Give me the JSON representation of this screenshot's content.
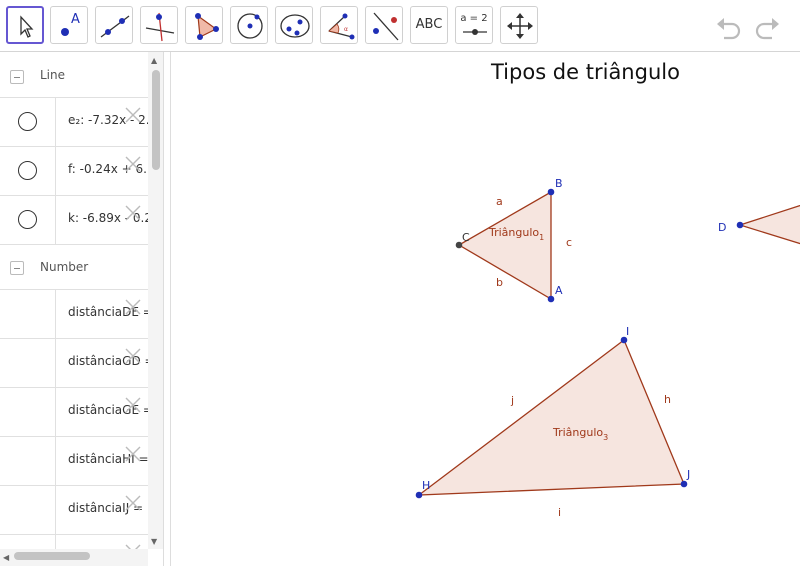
{
  "toolbar": {
    "tools": [
      {
        "name": "move-tool",
        "icon": "cursor-arrow-icon",
        "active": true
      },
      {
        "name": "point-tool",
        "icon": "point-icon",
        "label": "A"
      },
      {
        "name": "line-tool",
        "icon": "line-through-points-icon"
      },
      {
        "name": "perpendicular-line-tool",
        "icon": "perpendicular-line-icon"
      },
      {
        "name": "polygon-tool",
        "icon": "polygon-icon"
      },
      {
        "name": "circle-tool",
        "icon": "circle-center-point-icon"
      },
      {
        "name": "ellipse-tool",
        "icon": "ellipse-icon"
      },
      {
        "name": "angle-tool",
        "icon": "angle-icon"
      },
      {
        "name": "reflect-tool",
        "icon": "reflect-line-icon"
      },
      {
        "name": "text-tool",
        "icon": "text-icon",
        "label": "ABC"
      },
      {
        "name": "slider-tool",
        "icon": "slider-icon",
        "label": "a = 2"
      },
      {
        "name": "move-graphics-tool",
        "icon": "move-arrows-icon"
      }
    ],
    "undo_icon": "undo-icon",
    "redo_icon": "redo-icon"
  },
  "algebra": {
    "sections": [
      {
        "header": "Line",
        "items": [
          "e₂: -7.32x - 2.",
          "f: -0.24x + 6.",
          "k: -6.89x - 0.2"
        ]
      },
      {
        "header": "Number",
        "items": [
          "distânciaDE =",
          "distânciaGD =",
          "distânciaGE =",
          "distânciaHI =",
          "distânciaIJ ="
        ]
      }
    ]
  },
  "graphics": {
    "title": "Tipos de triângulo",
    "triangle_fill": "#f6e5df",
    "edge_color": "#a0391b",
    "point_color": "#1f2fb5",
    "triangles": [
      {
        "name": "Triângulo",
        "sub": "1",
        "points": [
          "A",
          "B",
          "C"
        ],
        "sides": [
          "a",
          "b",
          "c"
        ]
      },
      {
        "name": "Triângulo",
        "sub": "3",
        "points": [
          "H",
          "I",
          "J"
        ],
        "sides": [
          "h",
          "i",
          "j"
        ]
      }
    ],
    "point_labels": {
      "A": "A",
      "B": "B",
      "C": "C",
      "D": "D",
      "H": "H",
      "I": "I",
      "J": "J"
    },
    "side_labels": {
      "a": "a",
      "b": "b",
      "c": "c",
      "h": "h",
      "i": "i",
      "j": "j"
    }
  }
}
